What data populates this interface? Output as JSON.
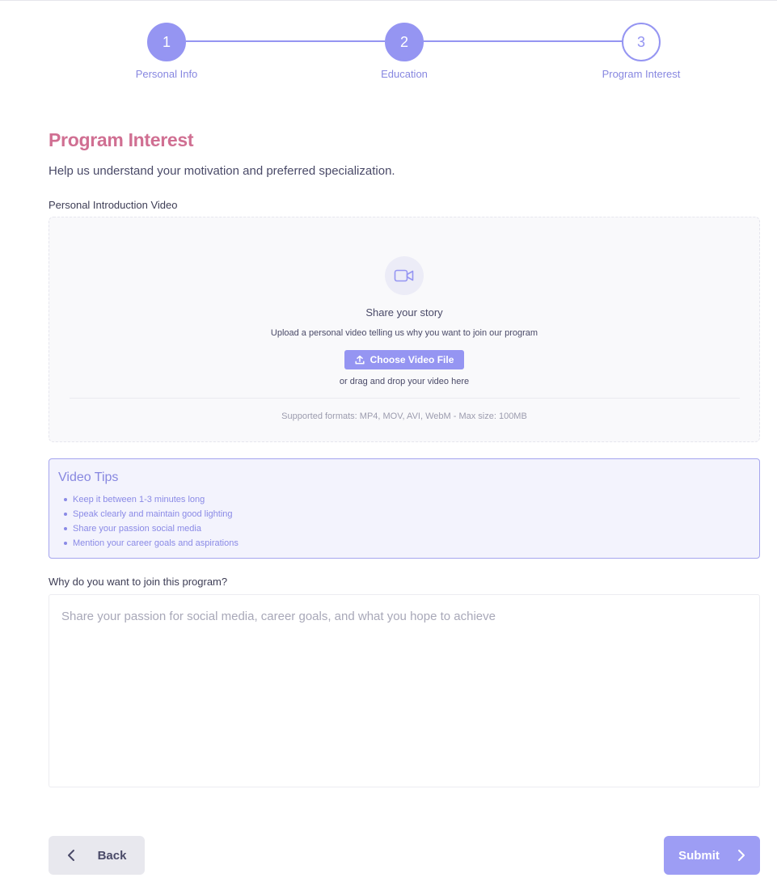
{
  "stepper": {
    "steps": [
      {
        "number": "1",
        "label": "Personal Info",
        "state": "completed"
      },
      {
        "number": "2",
        "label": "Education",
        "state": "completed"
      },
      {
        "number": "3",
        "label": "Program Interest",
        "state": "current"
      }
    ]
  },
  "section": {
    "title": "Program Interest",
    "subtitle": "Help us understand your motivation and preferred specialization."
  },
  "video_upload": {
    "label": "Personal Introduction Video",
    "icon": "video-camera-icon",
    "title": "Share your story",
    "description": "Upload a personal video telling us why you want to join our program",
    "button_label": "Choose Video File",
    "button_icon": "upload-icon",
    "drag_text": "or drag and drop your video here",
    "formats_text": "Supported formats: MP4, MOV, AVI, WebM - Max size: 100MB"
  },
  "tips": {
    "title": "Video Tips",
    "items": [
      "Keep it between 1-3 minutes long",
      "Speak clearly and maintain good lighting",
      "Share your passion social media",
      "Mention your career goals and aspirations"
    ]
  },
  "motivation": {
    "label": "Why do you want to join this program?",
    "value": "",
    "placeholder": "Share your passion for social media, career goals, and what you hope to achieve"
  },
  "footer": {
    "back_label": "Back",
    "back_icon": "chevron-left-icon",
    "submit_label": "Submit",
    "submit_icon": "chevron-right-icon"
  },
  "colors": {
    "accent": "#9595f2",
    "title": "#d06f92",
    "tips_background": "#f3f3fd",
    "back_button": "#e8e8ee"
  }
}
